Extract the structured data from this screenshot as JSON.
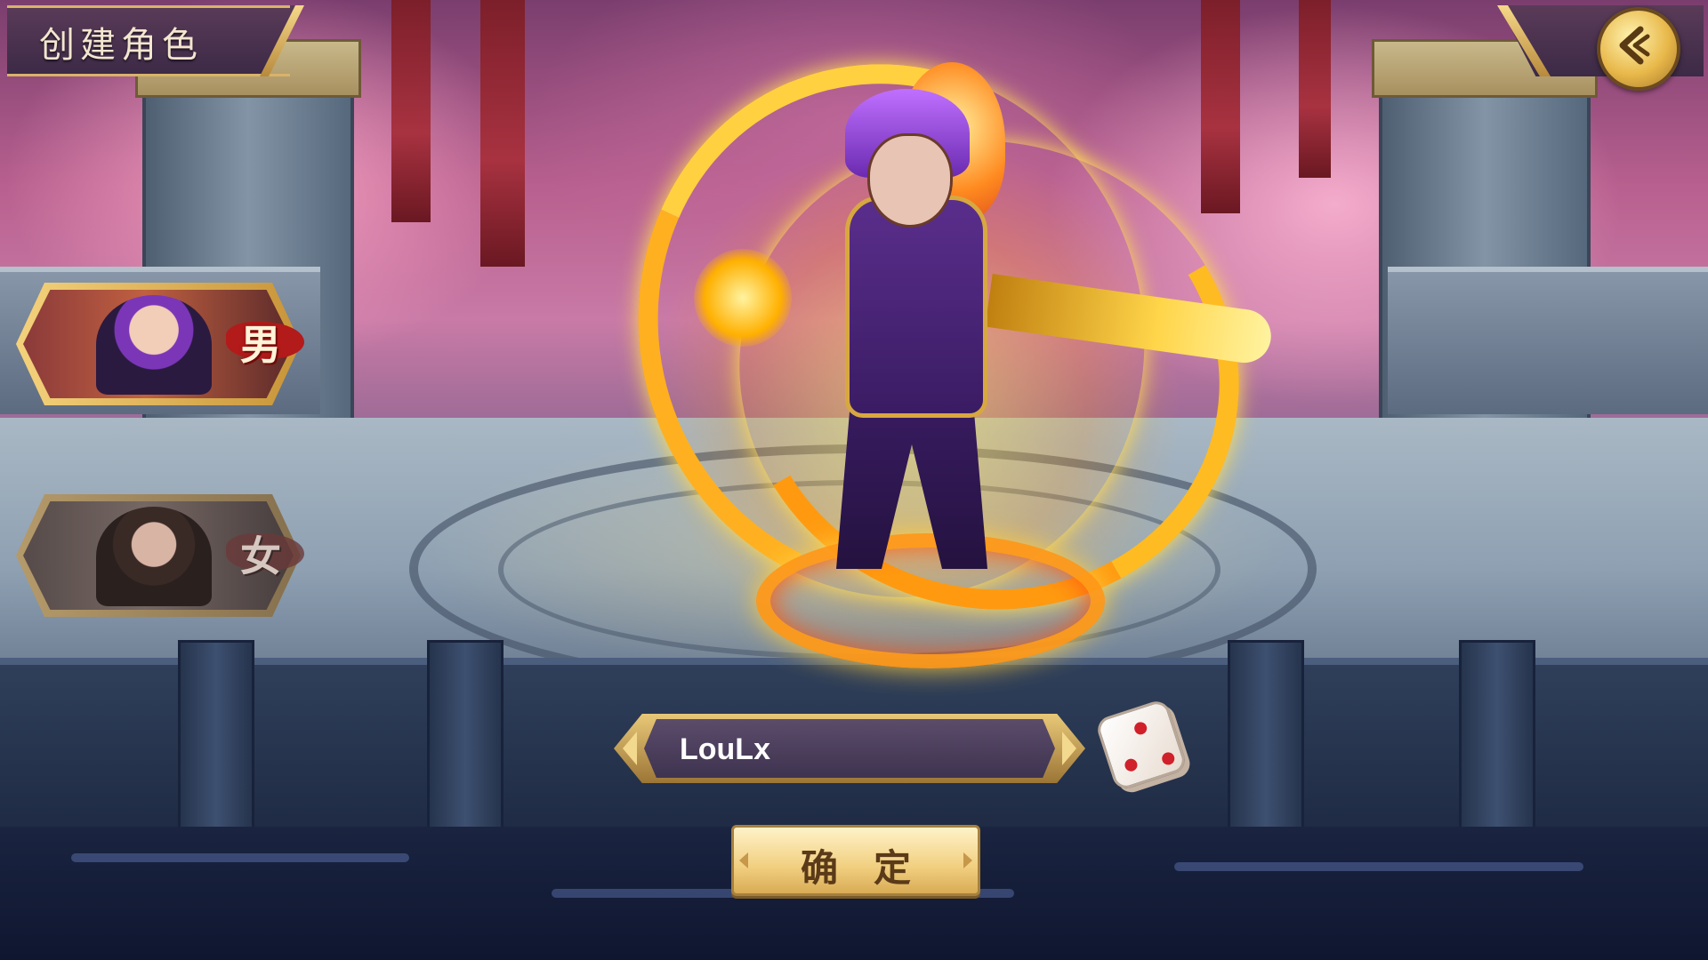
{
  "screen": {
    "title": "创建角色"
  },
  "header": {
    "back_icon": "back-arrow-icon"
  },
  "gender_options": [
    {
      "label": "男",
      "selected": true,
      "portrait": "male-hero-portrait"
    },
    {
      "label": "女",
      "selected": false,
      "portrait": "female-hero-portrait"
    }
  ],
  "name_field": {
    "value": "LouLx"
  },
  "random_name": {
    "icon": "dice-icon"
  },
  "confirm": {
    "label": "确定"
  },
  "colors": {
    "gold": "#e8c878",
    "panel": "#3c2a46",
    "fire": "#ffb020",
    "accent_red": "#d0202a"
  }
}
